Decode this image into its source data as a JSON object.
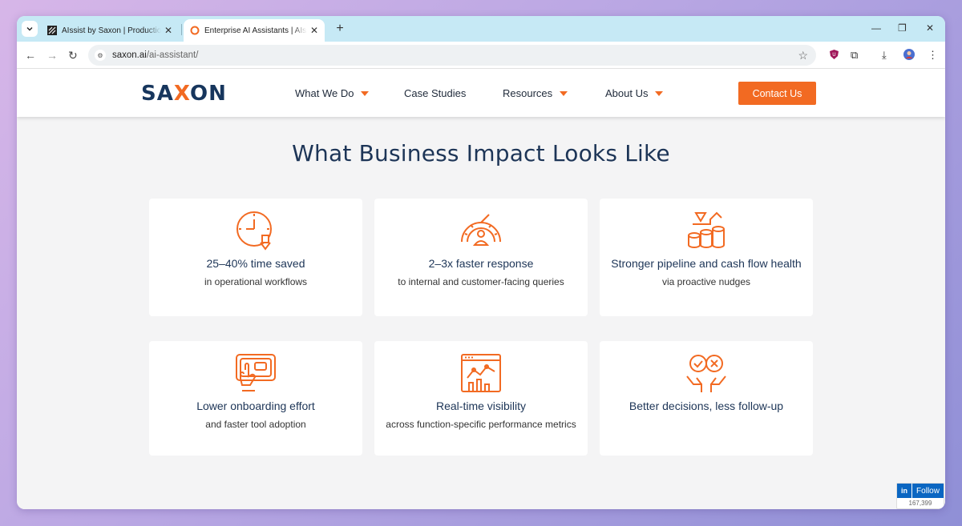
{
  "browser": {
    "tabs": [
      {
        "title": "AIssist by Saxon | Production | S"
      },
      {
        "title": "Enterprise AI Assistants | AIssist"
      }
    ],
    "url_host": "saxon.ai",
    "url_path": "/ai-assistant/"
  },
  "site": {
    "logo_left": "SA",
    "logo_mid": "X",
    "logo_right": "ON",
    "nav": [
      {
        "label": "What We Do"
      },
      {
        "label": "Case Studies"
      },
      {
        "label": "Resources"
      },
      {
        "label": "About Us"
      }
    ],
    "contact_label": "Contact Us"
  },
  "section": {
    "heading": "What Business Impact Looks Like",
    "cards": [
      {
        "icon": "clock-down-icon",
        "title": "25–40% time saved",
        "subtitle": "in operational workflows"
      },
      {
        "icon": "speedometer-person-icon",
        "title": "2–3x faster response",
        "subtitle": "to internal and customer-facing queries"
      },
      {
        "icon": "rocket-coins-icon",
        "title": "Stronger pipeline and cash flow health",
        "subtitle": "via proactive nudges"
      },
      {
        "icon": "hand-screen-icon",
        "title": "Lower onboarding effort",
        "subtitle": "and faster tool adoption"
      },
      {
        "icon": "analytics-chart-icon",
        "title": "Real-time visibility",
        "subtitle": "across function-specific performance metrics"
      },
      {
        "icon": "hands-decision-icon",
        "title": "Better decisions, less follow-up",
        "subtitle": ""
      }
    ]
  },
  "linkedin": {
    "in": "in",
    "follow": "Follow",
    "count": "167,399"
  },
  "colors": {
    "accent": "#f26a22",
    "navy": "#1d3557"
  }
}
